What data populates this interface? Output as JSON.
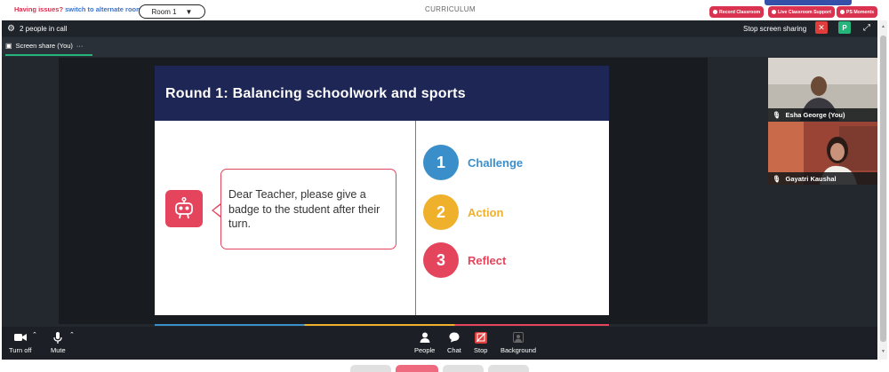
{
  "topbar": {
    "issues_label": "Having issues?",
    "alternate_link": "switch to alternate room",
    "room_select": "Room 1",
    "caret": "▼",
    "center_title": "CURRICULUM",
    "buttons": [
      "Record Classroom",
      "Live Classroom Support",
      "PS Moments"
    ],
    "accent_color": "#d9334f"
  },
  "call": {
    "people_count": "2 people in call",
    "stop_sharing_label": "Stop screen sharing",
    "stop_x": "✕",
    "p_button": "P",
    "tab_label": "Screen share (You)",
    "tab_more": "···"
  },
  "slide": {
    "title": "Round 1:  Balancing schoolwork and sports",
    "bubble_text": "Dear Teacher, please give a badge to the student after their turn.",
    "steps": [
      {
        "num": "1",
        "label": "Challenge",
        "color": "#3a8fcb"
      },
      {
        "num": "2",
        "label": "Action",
        "color": "#efb02c"
      },
      {
        "num": "3",
        "label": "Reflect",
        "color": "#e5455c"
      }
    ],
    "header_color": "#1e2656"
  },
  "participants": [
    {
      "name": "Esha George (You)"
    },
    {
      "name": "Gayatri Kaushal"
    }
  ],
  "controls": {
    "turn_off": "Turn off",
    "mute": "Mute",
    "people": "People",
    "chat": "Chat",
    "stop": "Stop",
    "background": "Background"
  }
}
